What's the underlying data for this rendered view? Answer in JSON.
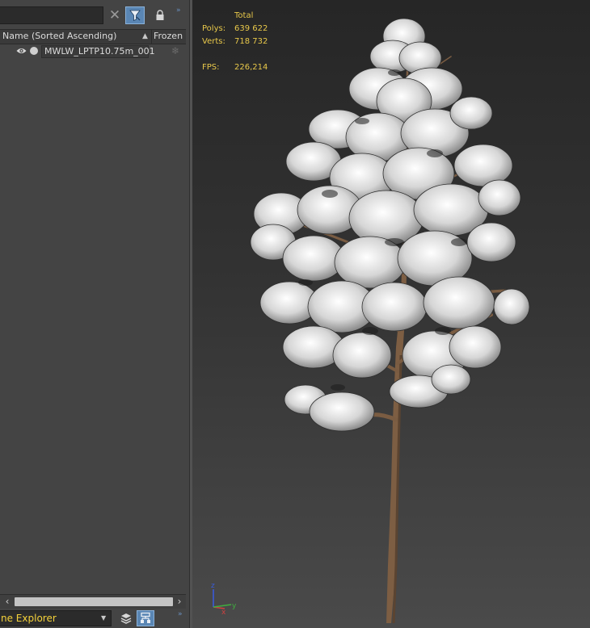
{
  "scene_explorer": {
    "search": {
      "value": "",
      "placeholder": ""
    },
    "toolbar": {
      "clear_icon": "close-icon",
      "filter_icon": "filter-icon",
      "lock_icon": "lock-icon",
      "more": "»"
    },
    "columns": {
      "name": "Name (Sorted Ascending)",
      "sort_indicator": "▲",
      "frozen": "Frozen"
    },
    "rows": [
      {
        "name": "MWLW_LPTP10.75m_001",
        "visible_icon": "eye-icon",
        "render_icon": "circle-icon",
        "frozen_icon": "snowflake-icon"
      }
    ],
    "scroll": {
      "left": "‹",
      "right": "›"
    },
    "bottom": {
      "explorer_label": "ne Explorer",
      "dropdown_icon": "chevron-down-icon",
      "layers_icon": "layers-icon",
      "hierarchy_icon": "hierarchy-icon",
      "more": "»"
    }
  },
  "viewport": {
    "stats": {
      "header": "Total",
      "polys_label": "Polys:",
      "polys_value": "639 622",
      "verts_label": "Verts:",
      "verts_value": "718 732",
      "fps_label": "FPS:",
      "fps_value": "226,214"
    },
    "gizmo": {
      "x": "x",
      "y": "y",
      "z": "z"
    },
    "colors": {
      "stats": "#e8c84a",
      "accent": "#5a86b4"
    }
  }
}
